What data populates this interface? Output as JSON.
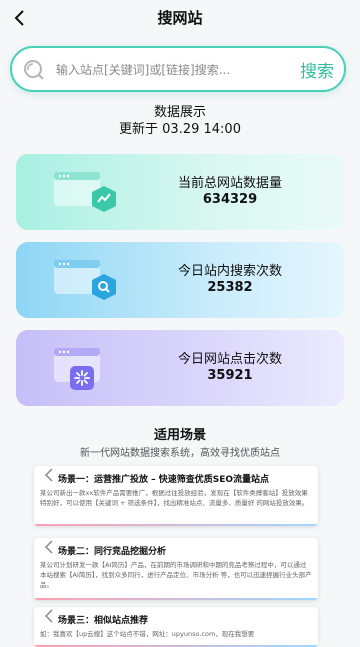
{
  "nav": {
    "title": "搜网站"
  },
  "search": {
    "placeholder": "输入站点[关键词]或[链接]搜索...",
    "button": "搜索"
  },
  "stats": {
    "title": "数据展示",
    "updated": "更新于 03.29 14:00"
  },
  "cards": [
    {
      "label": "当前总网站数据量",
      "value": "634329",
      "icon": "trend-icon",
      "color": "#39c9a8"
    },
    {
      "label": "今日站内搜索次数",
      "value": "25382",
      "icon": "search-icon",
      "color": "#2ba5e0"
    },
    {
      "label": "今日网站点击次数",
      "value": "35921",
      "icon": "click-icon",
      "color": "#7a6ef0"
    }
  ],
  "scenarios": {
    "title": "适用场景",
    "subtitle": "新一代网站数据搜索系统，高效寻找优质站点",
    "items": [
      {
        "title": "场景一：运营推广投放 – 快速筛查优质SEO流量站点",
        "body": "某公司新出一款xx软件产品需要推广，根据过往投放经验，发现在【软件类搏客站】投放效果特别好，可以使用【关键词 + 筛选条件】，找出精准站点、流量多、质量好 的网站投放效果。"
      },
      {
        "title": "场景二：同行竞品挖掘分析",
        "body": "某公司计划研发一款【AI简历】产品，在前期的市场调研和中期的竞品考察过程中，可以通过本站搜索【AI简历】，找到众多同行，进行产品定位、市场分析 等，也可以迅速捏握行业头部产品。"
      },
      {
        "title": "场景三：相似站点推荐",
        "body": "如：我喜欢【up云搜】这个站点不错，网址：upyunso.com，现在我想要"
      }
    ]
  }
}
